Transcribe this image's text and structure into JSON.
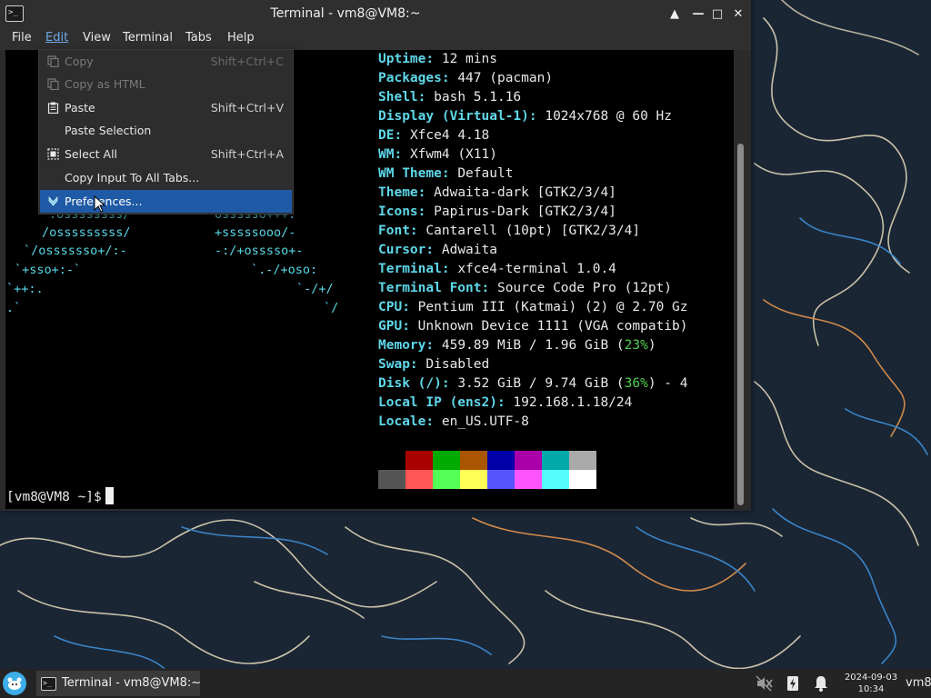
{
  "window": {
    "title": "Terminal - vm8@VM8:~",
    "app_icon_glyph": ">_",
    "controls": {
      "up": "▲",
      "minimize": "—",
      "maximize": "□",
      "close": "✕"
    }
  },
  "menubar": {
    "items": [
      "File",
      "Edit",
      "View",
      "Terminal",
      "Tabs",
      "Help"
    ],
    "active": "Edit"
  },
  "edit_menu": {
    "items": [
      {
        "label": "Copy",
        "shortcut": "Shift+Ctrl+C",
        "disabled": true,
        "icon": "copy-icon"
      },
      {
        "label": "Copy as HTML",
        "shortcut": "",
        "disabled": true,
        "icon": "copy-icon"
      },
      {
        "label": "Paste",
        "shortcut": "Shift+Ctrl+V",
        "disabled": false,
        "icon": "clipboard-icon"
      },
      {
        "label": "Paste Selection",
        "shortcut": "",
        "disabled": false,
        "icon": ""
      },
      {
        "label": "Select All",
        "shortcut": "Shift+Ctrl+A",
        "disabled": false,
        "icon": "select-all-icon"
      },
      {
        "label": "Copy Input To All Tabs...",
        "shortcut": "",
        "disabled": false,
        "icon": ""
      },
      {
        "label": "Preferences...",
        "shortcut": "",
        "disabled": false,
        "icon": "preferences-icon",
        "highlighted": true
      }
    ]
  },
  "terminal": {
    "ascii_art": [
      ".ossssssss/",
      "/osssssssss/",
      "`/osssssso+/:-",
      "`+sso+:-`",
      "`++:.",
      ".`"
    ],
    "ascii_art_right": [
      "ossssso+++.",
      "+sssssooo/-",
      "-:/+osssso+-",
      "`.-/+oso:",
      "`-/+/",
      "`/"
    ],
    "info": [
      {
        "key": "Uptime",
        "value": "12 mins"
      },
      {
        "key": "Packages",
        "value": "447 (pacman)"
      },
      {
        "key": "Shell",
        "value": "bash 5.1.16"
      },
      {
        "key": "Display (Virtual-1)",
        "value": "1024x768 @ 60 Hz"
      },
      {
        "key": "DE",
        "value": "Xfce4 4.18"
      },
      {
        "key": "WM",
        "value": "Xfwm4 (X11)"
      },
      {
        "key": "WM Theme",
        "value": "Default"
      },
      {
        "key": "Theme",
        "value": "Adwaita-dark [GTK2/3/4]"
      },
      {
        "key": "Icons",
        "value": "Papirus-Dark [GTK2/3/4]"
      },
      {
        "key": "Font",
        "value": "Cantarell (10pt) [GTK2/3/4]"
      },
      {
        "key": "Cursor",
        "value": "Adwaita"
      },
      {
        "key": "Terminal",
        "value": "xfce4-terminal 1.0.4"
      },
      {
        "key": "Terminal Font",
        "value": "Source Code Pro (12pt)"
      },
      {
        "key": "CPU",
        "value": "Pentium III (Katmai) (2) @ 2.70 Gz"
      },
      {
        "key": "GPU",
        "value": "Unknown Device 1111 (VGA compatib)"
      },
      {
        "key": "Memory",
        "value": "459.89 MiB / 1.96 GiB (",
        "pct": "23%",
        "suffix": ")"
      },
      {
        "key": "Swap",
        "value": "Disabled"
      },
      {
        "key": "Disk (/)",
        "value": "3.52 GiB / 9.74 GiB (",
        "pct": "36%",
        "suffix": ") - 4"
      },
      {
        "key": "Local IP (ens2)",
        "value": "192.168.1.18/24"
      },
      {
        "key": "Locale",
        "value": "en_US.UTF-8"
      }
    ],
    "palette_top": [
      "#000000",
      "#aa0000",
      "#00aa00",
      "#aa5500",
      "#0000aa",
      "#aa00aa",
      "#00aaaa",
      "#aaaaaa"
    ],
    "palette_bottom": [
      "#555555",
      "#ff5555",
      "#55ff55",
      "#ffff55",
      "#5555ff",
      "#ff55ff",
      "#55ffff",
      "#ffffff"
    ],
    "prompt": "[vm8@VM8 ~]$"
  },
  "taskbar": {
    "task_label": "Terminal - vm8@VM8:~",
    "clock_date": "2024-09-03",
    "clock_time": "10:34",
    "user": "vm8"
  },
  "colors": {
    "accent_blue": "#1f5aa6",
    "cyan": "#5fd8ea",
    "green_pct": "#4fcf4f",
    "wallpaper_bg": "#1a2634"
  }
}
